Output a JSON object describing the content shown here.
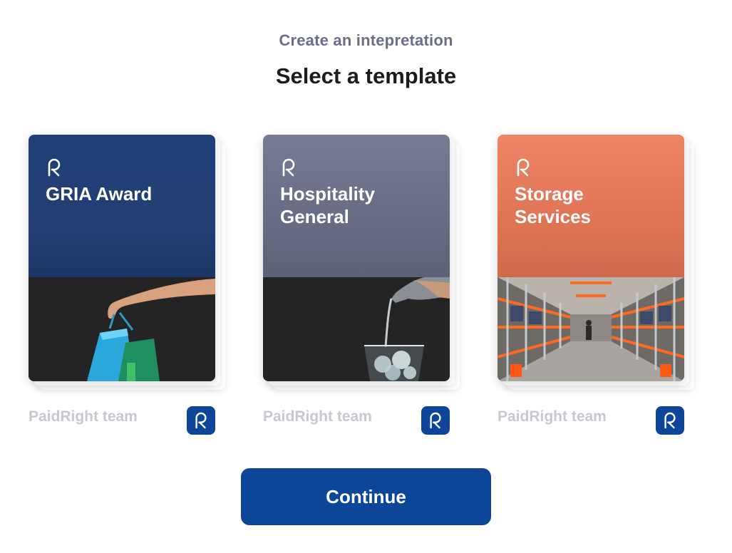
{
  "header": {
    "subtitle": "Create an intepretation",
    "title": "Select a template"
  },
  "templates": [
    {
      "title": "GRIA Award",
      "author": "PaidRight team",
      "image": "hand holding shopping bags"
    },
    {
      "title": "Hospitality\nGeneral",
      "author": "PaidRight team",
      "image": "water pouring into glass"
    },
    {
      "title": "Storage\nServices",
      "author": "PaidRight team",
      "image": "warehouse aisle with racks"
    }
  ],
  "icons": {
    "logo": "paidright-logo-icon"
  },
  "colors": {
    "primary": "#0d4599",
    "card1": "#1f3e77",
    "card2": "#6b6f87",
    "card3": "#e27a5c"
  },
  "footer": {
    "continue_label": "Continue"
  }
}
